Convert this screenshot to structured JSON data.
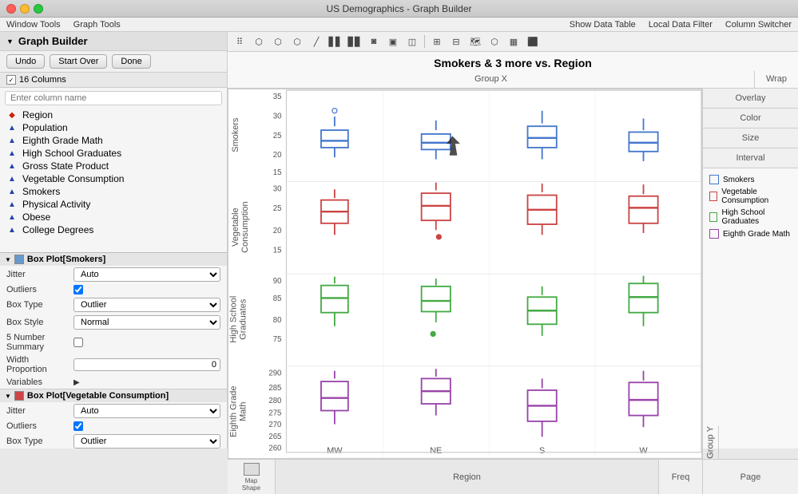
{
  "window": {
    "title": "US Demographics - Graph Builder",
    "buttons": {
      "close": "close",
      "minimize": "minimize",
      "maximize": "maximize"
    }
  },
  "menu": {
    "items": [
      "Window Tools",
      "Graph Tools"
    ],
    "right_items": [
      "Show Data Table",
      "Local Data Filter",
      "Column Switcher"
    ]
  },
  "graph_builder": {
    "title": "Graph Builder",
    "buttons": {
      "undo": "Undo",
      "start_over": "Start Over",
      "done": "Done"
    },
    "columns_header": "16 Columns",
    "search_placeholder": "Enter column name",
    "columns": [
      {
        "name": "Region",
        "type": "nominal"
      },
      {
        "name": "Population",
        "type": "continuous"
      },
      {
        "name": "Eighth Grade Math",
        "type": "continuous"
      },
      {
        "name": "High School Graduates",
        "type": "continuous"
      },
      {
        "name": "Gross State Product",
        "type": "continuous"
      },
      {
        "name": "Vegetable Consumption",
        "type": "continuous"
      },
      {
        "name": "Smokers",
        "type": "continuous"
      },
      {
        "name": "Physical Activity",
        "type": "continuous"
      },
      {
        "name": "Obese",
        "type": "continuous"
      },
      {
        "name": "College Degrees",
        "type": "continuous"
      }
    ]
  },
  "properties": {
    "section1": {
      "title": "Box Plot[Smokers]",
      "rows": [
        {
          "label": "Jitter",
          "type": "select",
          "value": "Auto"
        },
        {
          "label": "Outliers",
          "type": "checkbox",
          "checked": true
        },
        {
          "label": "Box Type",
          "type": "select",
          "value": "Outlier"
        },
        {
          "label": "Box Style",
          "type": "select",
          "value": "Normal"
        },
        {
          "label": "5 Number Summary",
          "type": "checkbox",
          "checked": false
        },
        {
          "label": "Width Proportion",
          "type": "input",
          "value": "0"
        },
        {
          "label": "Variables",
          "type": "arrow"
        }
      ]
    },
    "section2": {
      "title": "Box Plot[Vegetable Consumption]",
      "rows": [
        {
          "label": "Jitter",
          "type": "select",
          "value": "Auto"
        },
        {
          "label": "Outliers",
          "type": "checkbox",
          "checked": true
        },
        {
          "label": "Box Type",
          "type": "select",
          "value": "Outlier"
        }
      ]
    }
  },
  "chart": {
    "title": "Smokers & 3 more vs. Region",
    "group_x": "Group X",
    "wrap": "Wrap",
    "overlay_buttons": [
      "Overlay",
      "Color",
      "Size",
      "Interval"
    ],
    "group_y": "Group Y",
    "legend": [
      {
        "color": "blue",
        "label": "Smokers"
      },
      {
        "color": "red",
        "label": "Vegetable Consumption"
      },
      {
        "color": "green",
        "label": "High School Graduates"
      },
      {
        "color": "purple",
        "label": "Eighth Grade Math"
      }
    ],
    "x_axis_label": "Region",
    "x_axis_values": [
      "MW",
      "NE",
      "S",
      "W"
    ],
    "bottom_buttons": {
      "map_shape": "Map\nShape",
      "freq": "Freq",
      "page": "Page"
    }
  },
  "toolbar": {
    "icons": [
      "⋯⋯",
      "⬡",
      "📊",
      "📈",
      "📊",
      "⬛",
      "◉",
      "⬤",
      "▦",
      "◫",
      "▣",
      "⬜",
      "🗺",
      "⬡",
      "▦",
      "⬛"
    ]
  }
}
